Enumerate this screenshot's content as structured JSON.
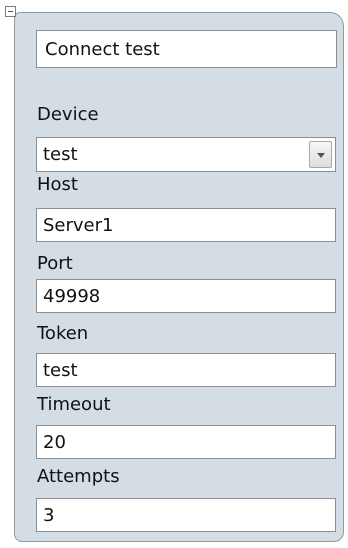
{
  "panel": {
    "name": "Connect test",
    "fields": {
      "device": {
        "label": "Device",
        "value": "test"
      },
      "host": {
        "label": "Host",
        "value": "Server1"
      },
      "port": {
        "label": "Port",
        "value": "49998"
      },
      "token": {
        "label": "Token",
        "value": "test"
      },
      "timeout": {
        "label": "Timeout",
        "value": "20"
      },
      "attempts": {
        "label": "Attempts",
        "value": "3"
      }
    }
  },
  "icons": {
    "collapse": "minus-box-icon",
    "dropdown": "triangle-down-icon"
  },
  "colors": {
    "panel_background": "#d3dde3",
    "panel_border": "#8f9aa1",
    "field_background": "#ffffff",
    "field_border": "#8b8f93",
    "text": "#111111"
  }
}
